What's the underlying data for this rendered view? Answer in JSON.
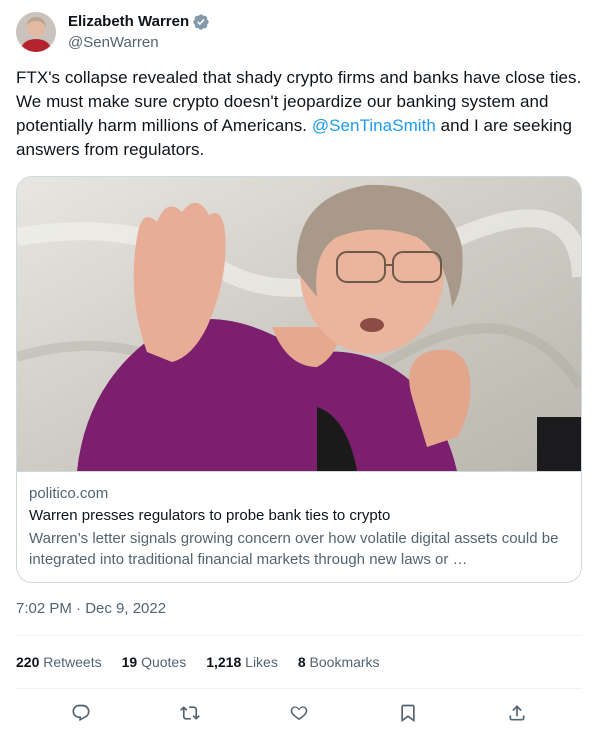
{
  "author": {
    "name": "Elizabeth Warren",
    "handle": "@SenWarren",
    "verified_badge_color": "#829aab",
    "avatar_icon": "person-portrait"
  },
  "tweet": {
    "text_part1": "FTX's collapse revealed that shady crypto firms and banks have close ties. We must make sure crypto doesn't jeopardize our banking system and potentially harm millions of Americans. ",
    "mention": "@SenTinaSmith",
    "text_part2": " and I are seeking answers from regulators.",
    "mention_color": "#1d9bf0"
  },
  "card": {
    "domain": "politico.com",
    "title": "Warren presses regulators to probe bank ties to crypto",
    "description": "Warren’s letter signals growing concern over how volatile digital assets could be integrated into traditional financial markets through new laws or …"
  },
  "timestamp": "7:02 PM · Dec 9, 2022",
  "stats": {
    "retweets_count": "220",
    "retweets_label": "Retweets",
    "quotes_count": "19",
    "quotes_label": "Quotes",
    "likes_count": "1,218",
    "likes_label": "Likes",
    "bookmarks_count": "8",
    "bookmarks_label": "Bookmarks"
  },
  "actions": [
    "reply-icon",
    "retweet-icon",
    "like-icon",
    "bookmark-icon",
    "share-icon"
  ],
  "colors": {
    "text": "#0f1419",
    "secondary": "#536471",
    "border": "#cfd9de"
  }
}
